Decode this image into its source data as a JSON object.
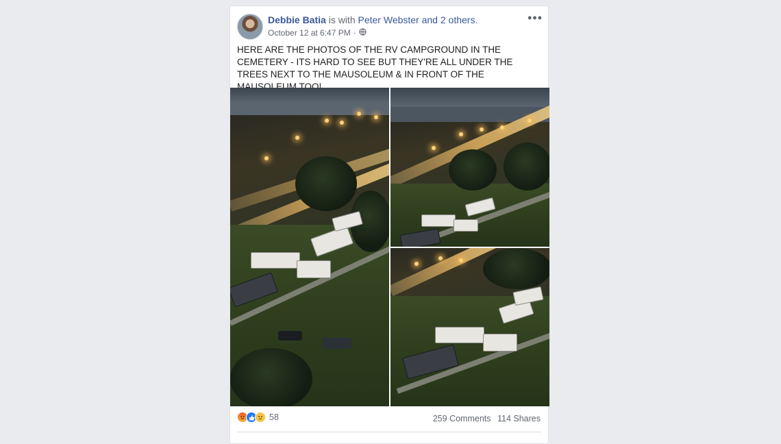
{
  "post": {
    "author": "Debbie Batia",
    "with_text": "is with",
    "tagged": "Peter Webster and 2 others.",
    "timestamp": "October 12 at 6:47 PM",
    "privacy_separator": "·",
    "privacy_icon": "globe-icon",
    "more_icon": "more-options-icon",
    "more_label": "•••",
    "text": "HERE ARE THE PHOTOS OF THE RV CAMPGROUND IN THE CEMETERY - ITS HARD TO SEE BUT THEY'RE ALL UNDER THE TREES NEXT TO THE MAUSOLEUM & IN FRONT OF THE MAUSOLEUM TOO!",
    "photos": [
      {
        "icon": "photo-rv-campground-1"
      },
      {
        "icon": "photo-rv-campground-2"
      },
      {
        "icon": "photo-rv-campground-3"
      }
    ]
  },
  "footer": {
    "reactions": [
      "angry",
      "like",
      "sad"
    ],
    "reaction_count": "58",
    "comments": "259 Comments",
    "shares": "114 Shares"
  },
  "colors": {
    "link": "#385898",
    "background": "#e9ebee",
    "meta": "#616770"
  }
}
